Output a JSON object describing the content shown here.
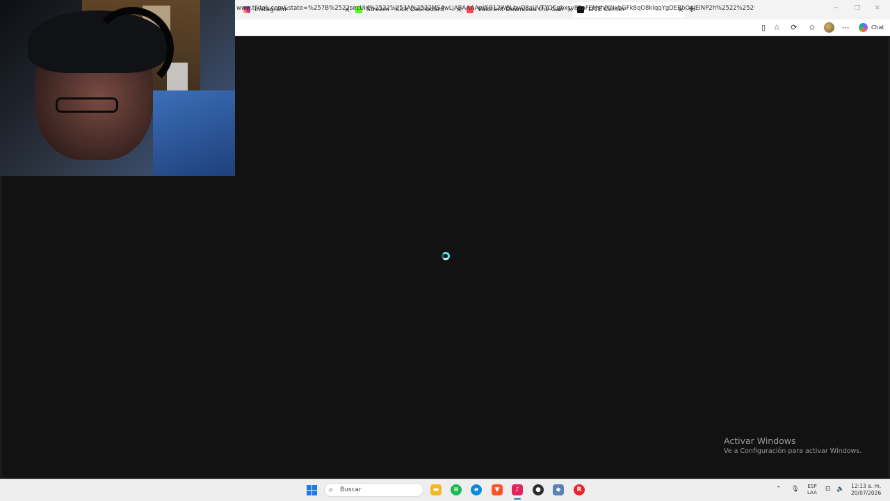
{
  "browser": {
    "tabs": [
      {
        "label": "Instagram",
        "favicon_color": "#d6249f",
        "active": false
      },
      {
        "label": "Stream - Kick Dashboard",
        "favicon_color": "#53fc18",
        "active": false
      },
      {
        "label": "Valorant Download the Game",
        "favicon_color": "#ff4655",
        "active": false
      },
      {
        "label": "LIVE Center",
        "favicon_color": "#000000",
        "active": true
      }
    ],
    "close_glyph": "×",
    "new_tab_glyph": "+",
    "url": "www.tiktok.com&state=%257B%2522secUid%2522%253A%2522MS4wLjABAAAApIGB12W8LbvQ8aUVTYOCqbxsv82aFEMshlXNxbGFk8qO8kIqqYgDEBbOpjEINP2h%2522%252C%2...",
    "chat_label": "Chat"
  },
  "page": {
    "state": "loading",
    "spinner_color": "#5ee7ea"
  },
  "watermark": {
    "title": "Activar Windows",
    "subtitle": "Ve a Configuración para activar Windows."
  },
  "taskbar": {
    "search_placeholder": "Buscar",
    "apps": [
      {
        "name": "file-explorer",
        "color": "#f2b827"
      },
      {
        "name": "spotify",
        "color": "#1db954"
      },
      {
        "name": "edge",
        "color": "#0c8ad6"
      },
      {
        "name": "brave",
        "color": "#fb542b"
      },
      {
        "name": "tiktok-live-studio",
        "color": "#e2245c"
      },
      {
        "name": "obs",
        "color": "#2b2b2b"
      },
      {
        "name": "vpn",
        "color": "#5b7fb8"
      },
      {
        "name": "riot-client",
        "color": "#e8232a"
      }
    ],
    "language": [
      "ESP",
      "LAA"
    ],
    "time": "12:13 a. m.",
    "date": "20/07/2026"
  }
}
